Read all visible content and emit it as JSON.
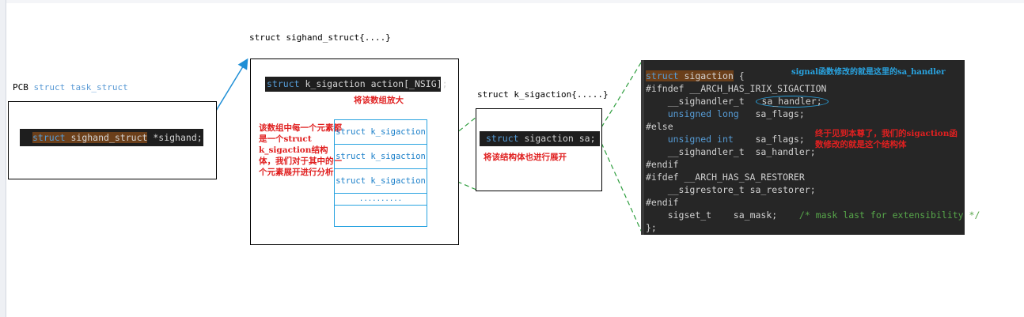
{
  "pcb": {
    "title_prefix": "PCB",
    "title_kw": "struct",
    "title_name": "task_struct",
    "member_kw": "struct",
    "member_type": "sighand_struct",
    "member_field": "*sighand;"
  },
  "sighand": {
    "title": "struct sighand_struct{....}",
    "action_kw": "struct",
    "action_decl": "k_sigaction  action[_NSIG];",
    "zoom_note": "将该数组放大",
    "desc": "该数组中每一个元素都是一个struct k_sigaction结构体，我们对于其中的一个元素展开进行分析",
    "cells": [
      "struct k_sigaction",
      "struct k_sigaction",
      "struct k_sigaction",
      ".........."
    ]
  },
  "ksig": {
    "title": "struct k_sigaction{.....}",
    "member_kw": "struct",
    "member_decl": "sigaction sa;",
    "note": "将该结构体也进行展开"
  },
  "panel": {
    "note_top": "signal函数修改的就是这里的sa_handler",
    "note_mid": "终于见到本尊了，我们的sigaction函数修改的就是这个结构体",
    "lines": {
      "l1_kw": "struct",
      "l1_name": "sigaction",
      "l1_brace": "{",
      "l2": "#ifndef __ARCH_HAS_IRIX_SIGACTION",
      "l3_type": "__sighandler_t",
      "l3_field": "sa_handler;",
      "l4_kw": "unsigned long",
      "l4_field": "sa_flags;",
      "l5": "#else",
      "l6_kw": "unsigned int",
      "l6_field": "sa_flags;",
      "l7_type": "__sighandler_t",
      "l7_field": "sa_handler;",
      "l8": "#endif",
      "l9": "#ifdef __ARCH_HAS_SA_RESTORER",
      "l10_type": "__sigrestore_t",
      "l10_field": "sa_restorer;",
      "l11": "#endif",
      "l12_type": "sigset_t",
      "l12_field": "sa_mask;",
      "l12_comment": "/* mask last for extensibility */",
      "l13": "};"
    }
  },
  "colors": {
    "arrow_blue": "#1f8fd6",
    "dash_green": "#2e9e3e",
    "note_red": "#e02020",
    "cell_blue": "#29a3e0"
  }
}
